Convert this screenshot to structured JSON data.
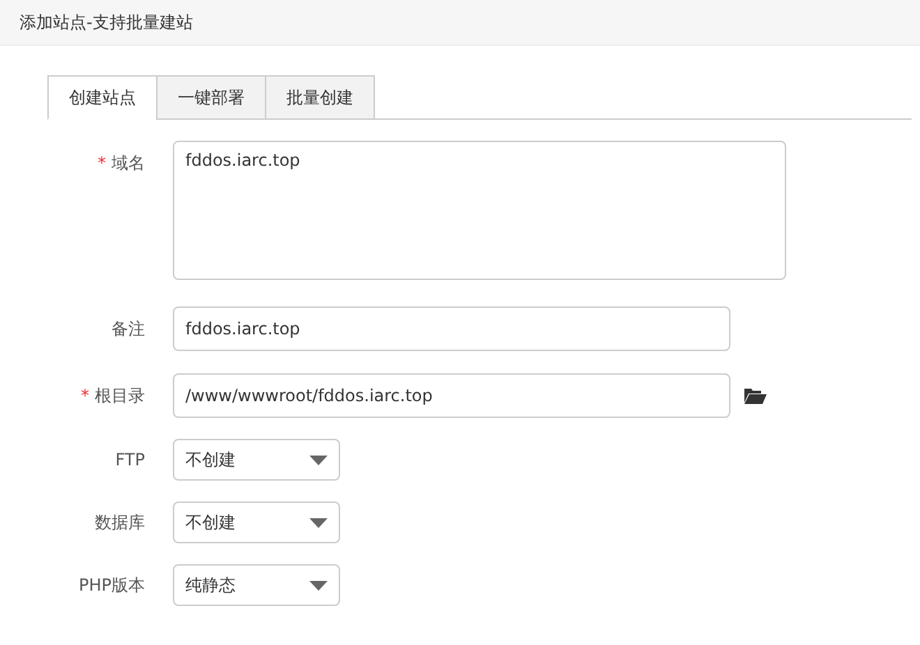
{
  "window": {
    "title": "添加站点-支持批量建站"
  },
  "tabs": [
    {
      "label": "创建站点",
      "selected": true
    },
    {
      "label": "一键部署",
      "selected": false
    },
    {
      "label": "批量创建",
      "selected": false
    }
  ],
  "form": [
    {
      "kind": "textarea",
      "label": "域名",
      "required_mark": "*",
      "value": "fddos.iarc.top"
    },
    {
      "kind": "input",
      "label": "备注",
      "value": "fddos.iarc.top"
    },
    {
      "kind": "path",
      "label": "根目录",
      "required_mark": "*",
      "value": "/www/wwwroot/fddos.iarc.top"
    },
    {
      "kind": "select",
      "label": "FTP",
      "value": "不创建"
    },
    {
      "kind": "select",
      "label": "数据库",
      "value": "不创建"
    },
    {
      "kind": "select",
      "label": "PHP版本",
      "value": "纯静态"
    }
  ]
}
